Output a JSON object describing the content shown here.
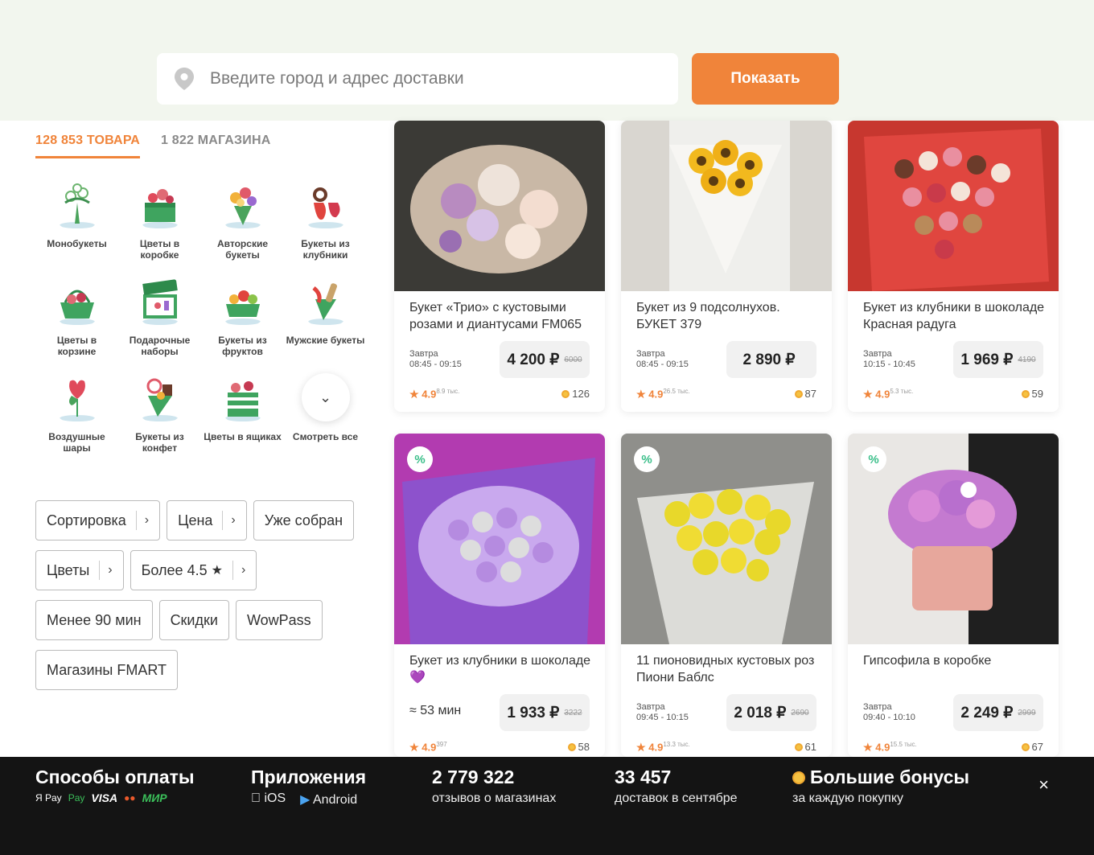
{
  "search": {
    "placeholder": "Введите город и адрес доставки",
    "button": "Показать"
  },
  "tabs": [
    {
      "label": "128 853 ТОВАРА"
    },
    {
      "label": "1 822 МАГАЗИНА"
    }
  ],
  "categories": [
    {
      "label": "Монобукеты",
      "icon": "monobouquet-icon"
    },
    {
      "label": "Цветы в коробке",
      "icon": "flowers-box-icon"
    },
    {
      "label": "Авторские букеты",
      "icon": "author-bouquet-icon"
    },
    {
      "label": "Букеты из клубники",
      "icon": "strawberry-bouquet-icon"
    },
    {
      "label": "Цветы в корзине",
      "icon": "flowers-basket-icon"
    },
    {
      "label": "Подарочные наборы",
      "icon": "gift-set-icon"
    },
    {
      "label": "Букеты из фруктов",
      "icon": "fruit-bouquet-icon"
    },
    {
      "label": "Мужские букеты",
      "icon": "mens-bouquet-icon"
    },
    {
      "label": "Воздушные шары",
      "icon": "balloons-icon"
    },
    {
      "label": "Букеты из конфет",
      "icon": "candy-bouquet-icon"
    },
    {
      "label": "Цветы в ящиках",
      "icon": "flowers-crate-icon"
    },
    {
      "label": "Смотреть все",
      "icon": "chevron-down-icon"
    }
  ],
  "filters": [
    {
      "label": "Сортировка",
      "arrow": "›"
    },
    {
      "label": "Цена",
      "arrow": "›"
    },
    {
      "label": "Уже собран"
    },
    {
      "label": "Цветы",
      "arrow": "›"
    },
    {
      "label": "Более 4.5",
      "star": "★",
      "arrow": "›"
    },
    {
      "label": "Менее 90 мин"
    },
    {
      "label": "Скидки"
    },
    {
      "label": "WowPass"
    },
    {
      "label": "Магазины FMART"
    }
  ],
  "products": [
    {
      "title": "Букет «Трио» с кустовыми розами и диантусами FM065",
      "when": "Завтра",
      "time": "08:45 - 09:15",
      "price": "4 200 ₽",
      "old": "6000",
      "rating": "★ 4.9",
      "votes": "8.9 тыс.",
      "reviews": "126",
      "badge": ""
    },
    {
      "title": "Букет из 9 подсолнухов. БУКЕТ 379",
      "when": "Завтра",
      "time": "08:45 - 09:15",
      "price": "2 890 ₽",
      "old": "",
      "rating": "★ 4.9",
      "votes": "26.5 тыс.",
      "reviews": "87",
      "badge": ""
    },
    {
      "title": "Букет из клубники в шоколаде Красная радуга",
      "when": "Завтра",
      "time": "10:15 - 10:45",
      "price": "1 969 ₽",
      "old": "4190",
      "rating": "★ 4.9",
      "votes": "5.3 тыс.",
      "reviews": "59",
      "badge": ""
    },
    {
      "title": "Букет из клубники в шоколаде 💜",
      "when": "≈ 53 мин",
      "time": "",
      "price": "1 933 ₽",
      "old": "3222",
      "rating": "★ 4.9",
      "votes": "397",
      "reviews": "58",
      "badge": "%"
    },
    {
      "title": "11 пионовидных кустовых роз Пиони Баблс",
      "when": "Завтра",
      "time": "09:45 - 10:15",
      "price": "2 018 ₽",
      "old": "2690",
      "rating": "★ 4.9",
      "votes": "13.3 тыс.",
      "reviews": "61",
      "badge": "%"
    },
    {
      "title": "Гипсофила в коробке",
      "when": "Завтра",
      "time": "09:40 - 10:10",
      "price": "2 249 ₽",
      "old": "2999",
      "rating": "★ 4.9",
      "votes": "15.5 тыс.",
      "reviews": "67",
      "badge": "%"
    }
  ],
  "footer": {
    "payment": {
      "title": "Способы оплаты",
      "methods": [
        "Я Pay",
        "Pay",
        "VISA",
        "●●",
        "МИР"
      ]
    },
    "apps": {
      "title": "Приложения",
      "ios": "iOS",
      "android": "Android"
    },
    "reviews": {
      "title": "2 779 322",
      "sub": "отзывов о магазинах"
    },
    "deliveries": {
      "title": "33 457",
      "sub": "доставок в сентябре"
    },
    "bonus": {
      "title": "Большие бонусы",
      "sub": "за каждую покупку"
    },
    "close": "×"
  }
}
